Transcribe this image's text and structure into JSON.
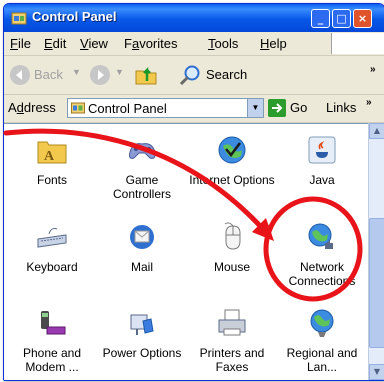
{
  "window": {
    "title": "Control Panel",
    "title_icon": "control-panel-icon",
    "caption_buttons": [
      "minimize",
      "maximize",
      "close"
    ]
  },
  "menubar": {
    "items": [
      {
        "pre": "",
        "acc": "F",
        "post": "ile"
      },
      {
        "pre": "",
        "acc": "E",
        "post": "dit"
      },
      {
        "pre": "",
        "acc": "V",
        "post": "iew"
      },
      {
        "pre": "F",
        "acc": "a",
        "post": "vorites"
      },
      {
        "pre": "",
        "acc": "T",
        "post": "ools"
      },
      {
        "pre": "",
        "acc": "H",
        "post": "elp"
      }
    ]
  },
  "toolbar": {
    "back_label": "Back",
    "search_label": "Search",
    "more": "»"
  },
  "addressbar": {
    "label_acc": "d",
    "label_pre": "A",
    "label_post": "dress",
    "value": "Control Panel",
    "go_label": "Go",
    "links_label": "Links",
    "links_chevron": "»"
  },
  "items": [
    {
      "name": "Fonts",
      "icon": "fonts-folder-icon"
    },
    {
      "name": "Game Controllers",
      "icon": "game-controller-icon"
    },
    {
      "name": "Internet Options",
      "icon": "internet-options-icon"
    },
    {
      "name": "Java",
      "icon": "java-icon"
    },
    {
      "name": "Keyboard",
      "icon": "keyboard-icon"
    },
    {
      "name": "Mail",
      "icon": "mail-icon"
    },
    {
      "name": "Mouse",
      "icon": "mouse-icon"
    },
    {
      "name": "Network Connections",
      "icon": "network-connections-icon"
    },
    {
      "name": "Phone and Modem ...",
      "icon": "phone-modem-icon"
    },
    {
      "name": "Power Options",
      "icon": "power-options-icon"
    },
    {
      "name": "Printers and Faxes",
      "icon": "printers-faxes-icon"
    },
    {
      "name": "Regional and Lan...",
      "icon": "regional-language-icon"
    }
  ],
  "annotation": {
    "color": "#e8141a",
    "target": "Network Connections"
  },
  "colors": {
    "titlebar": "#0758e8",
    "window_bg": "#ece9d8",
    "content_bg": "#ffffff"
  }
}
